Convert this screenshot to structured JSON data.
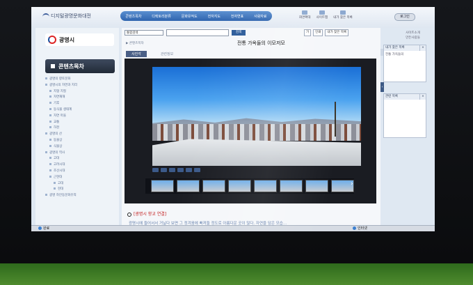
{
  "header": {
    "site_title": "디지털광명문화대전",
    "nav": [
      "콘텐츠목차",
      "디렉토리분류",
      "문화유적도",
      "전자지도",
      "전자연표",
      "사람자료"
    ],
    "util": [
      "화면확대",
      "사이트맵",
      "내가 찾은 목록"
    ],
    "login": "로그인"
  },
  "left": {
    "logo_text": "광명시",
    "nav_title": "콘텐츠목차",
    "tree": [
      {
        "level": 1,
        "text": "광명의 향토문화"
      },
      {
        "level": 1,
        "text": "광명시의 자연과 지리"
      },
      {
        "level": 2,
        "text": "지형 지질"
      },
      {
        "level": 2,
        "text": "자연재해"
      },
      {
        "level": 2,
        "text": "기후"
      },
      {
        "level": 2,
        "text": "동식물 생태계"
      },
      {
        "level": 2,
        "text": "자연 마을"
      },
      {
        "level": 2,
        "text": "교통"
      },
      {
        "level": 2,
        "text": "하천"
      },
      {
        "level": 1,
        "text": "광명의 산"
      },
      {
        "level": 2,
        "text": "동물상"
      },
      {
        "level": 2,
        "text": "식물상"
      },
      {
        "level": 1,
        "text": "광명의 역사"
      },
      {
        "level": 2,
        "text": "고대"
      },
      {
        "level": 2,
        "text": "고려시대"
      },
      {
        "level": 2,
        "text": "조선시대"
      },
      {
        "level": 2,
        "text": "근현대"
      },
      {
        "level": 3,
        "text": "고대"
      },
      {
        "level": 3,
        "text": "현대"
      },
      {
        "level": 1,
        "text": "광명 하안동문화유적"
      }
    ]
  },
  "main": {
    "search_select": "통합검색",
    "search_button": "검색",
    "tools": [
      "가",
      "인쇄",
      "내가 찾은 목록"
    ],
    "crumb": "▶ 콘텐츠목차",
    "title": "전통 가옥들의 이모저모",
    "tabs": [
      "사진각",
      "관련정보"
    ],
    "section_title": "[광명시 향교 연결]",
    "paragraph": "광명시에 들어서서 거닐다 보면 그 정겨움에 빠져들 정도로 아름다운 곳이 많다. 자연을 담은 모습..."
  },
  "right": {
    "links": [
      "사이트소개",
      "만든사람들"
    ],
    "box1_title": "내가 찾은 목록",
    "box1_item": "전통 가옥들의",
    "box2_title": "관련 목록"
  },
  "status": {
    "left": "완료",
    "right": "인터넷"
  }
}
